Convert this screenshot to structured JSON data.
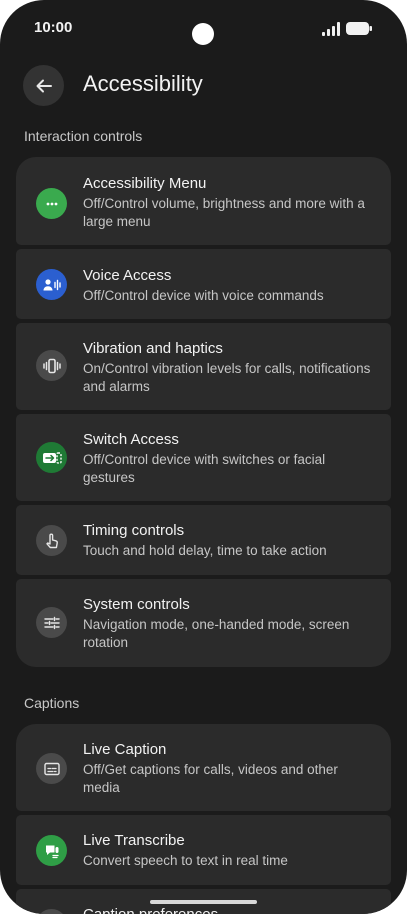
{
  "status": {
    "time": "10:00"
  },
  "header": {
    "title": "Accessibility"
  },
  "sections": {
    "interaction": "Interaction controls",
    "captions": "Captions"
  },
  "items": [
    {
      "title": "Accessibility Menu",
      "summary": "Off/Control volume, brightness and more with a large menu",
      "icon": "dots-icon",
      "color": "#3aaa4e"
    },
    {
      "title": "Voice Access",
      "summary": "Off/Control device with voice commands",
      "icon": "voice-icon",
      "color": "#2b5fd0"
    },
    {
      "title": "Vibration and haptics",
      "summary": "On/Control vibration levels for calls, notifications and alarms",
      "icon": "vibration-icon",
      "color": "#4a4a4a"
    },
    {
      "title": "Switch Access",
      "summary": "Off/Control device with switches or facial gestures",
      "icon": "switch-icon",
      "color": "#1f7a35"
    },
    {
      "title": "Timing controls",
      "summary": "Touch and hold delay, time to take action",
      "icon": "touch-icon",
      "color": "#4a4a4a"
    },
    {
      "title": "System controls",
      "summary": "Navigation mode, one-handed mode, screen rotation",
      "icon": "sliders-icon",
      "color": "#4a4a4a"
    },
    {
      "title": "Live Caption",
      "summary": "Off/Get captions for calls, videos and other media",
      "icon": "caption-icon",
      "color": "#4a4a4a"
    },
    {
      "title": "Live Transcribe",
      "summary": "Convert speech to text in real time",
      "icon": "transcribe-icon",
      "color": "#2f9e46"
    },
    {
      "title": "Caption preferences",
      "icon": "caption-prefs-icon",
      "color": "#4a4a4a"
    }
  ]
}
